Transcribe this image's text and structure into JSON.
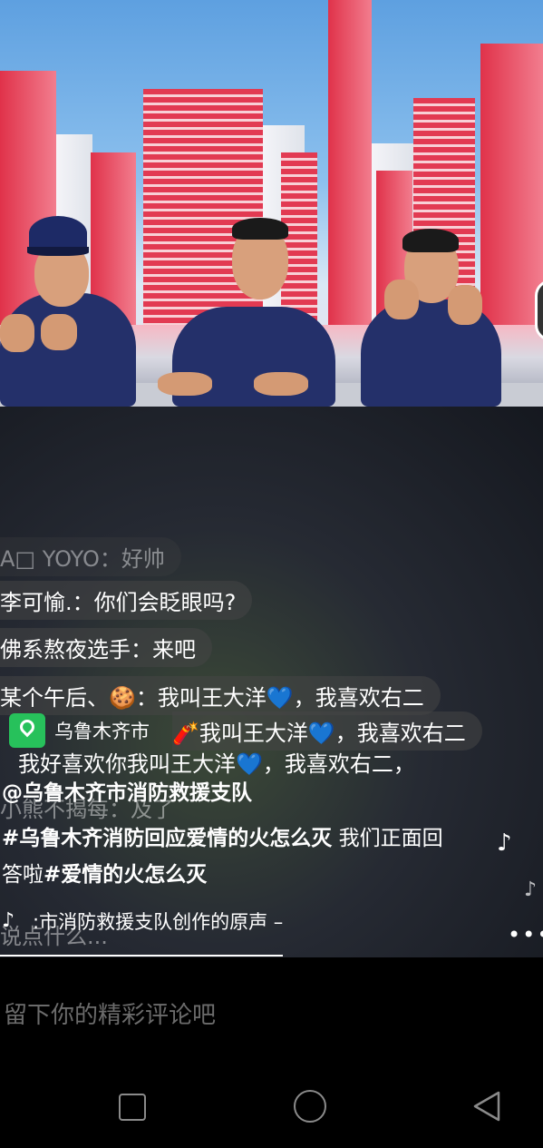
{
  "chat": [
    {
      "text": "A□ YOYO：好帅",
      "dim": true
    },
    {
      "text": "李可愉.：你们会眨眼吗?"
    },
    {
      "text": "佛系熬夜选手：来吧"
    },
    {
      "text": "某个午后、🍪：我叫王大洋💙，我喜欢右二"
    },
    {
      "text": "🧨我叫王大洋💙，我喜欢右二"
    },
    {
      "text": "我好喜欢你我叫王大洋💙，我喜欢右二，"
    },
    {
      "text": "小熊不揭每：及了",
      "dim": true
    },
    {
      "text": "说点什么...",
      "dim": true
    }
  ],
  "location": {
    "icon": "location-pin-icon",
    "label": "乌鲁木齐市"
  },
  "author": "@乌鲁木齐市消防救援支队",
  "caption": {
    "hashtag1": "#乌鲁木齐消防回应爱情的火怎么灭",
    "text": " 我们正面回答啦",
    "hashtag2": "#爱情的火怎么灭"
  },
  "music": {
    "icon": "tiktok-icon",
    "text": ":市消防救援支队创作的原声 –"
  },
  "comment_placeholder": "留下你的精彩评论吧",
  "nav": {
    "recents": "recents-icon",
    "home": "home-icon",
    "back": "back-icon"
  }
}
